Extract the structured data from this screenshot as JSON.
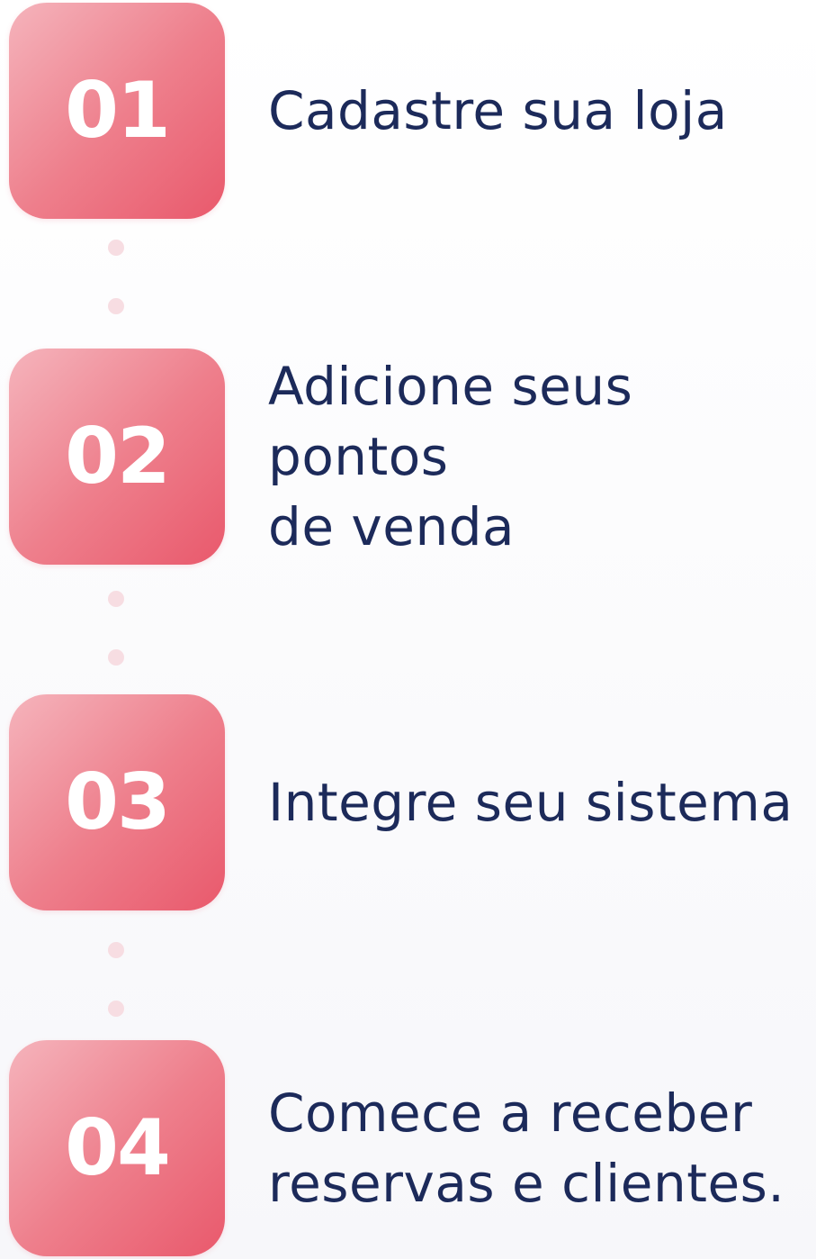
{
  "steps": [
    {
      "number": "01",
      "label": "Cadastre sua loja"
    },
    {
      "number": "02",
      "label": "Adicione seus pontos\nde venda"
    },
    {
      "number": "03",
      "label": "Integre seu sistema"
    },
    {
      "number": "04",
      "label": "Comece a  receber\nreservas e clientes."
    }
  ],
  "colors": {
    "badge_gradient_start": "#f5b4bc",
    "badge_gradient_end": "#e9596c",
    "text": "#1c2a5a",
    "connector_dot": "#f7dde2"
  }
}
